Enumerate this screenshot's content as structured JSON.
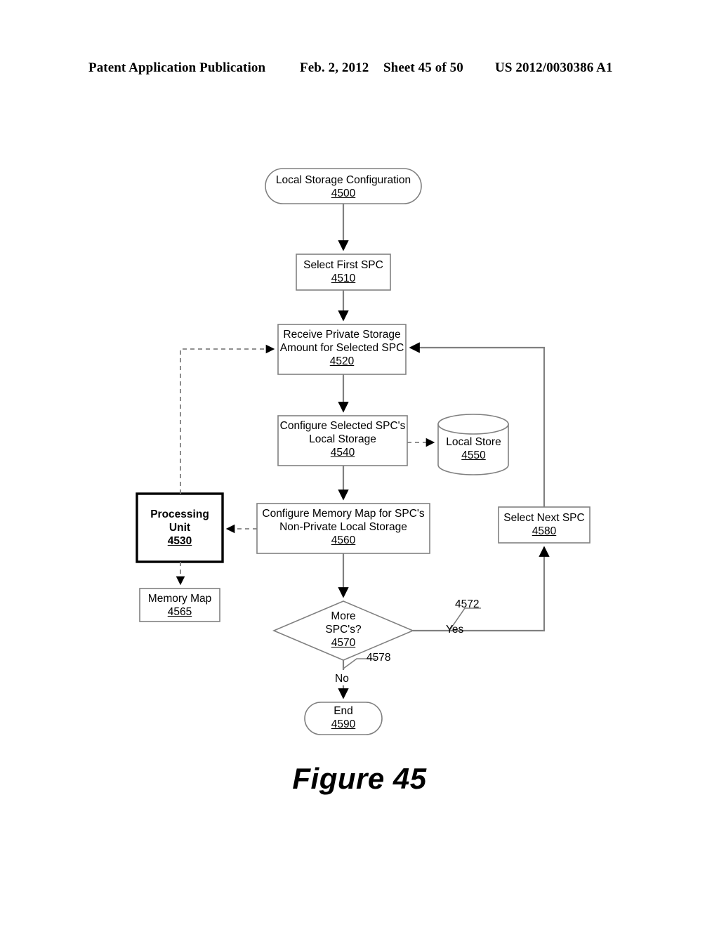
{
  "header": {
    "publication": "Patent Application Publication",
    "date": "Feb. 2, 2012",
    "sheet": "Sheet 45 of 50",
    "patent_number": "US 2012/0030386 A1"
  },
  "figure": {
    "caption": "Figure 45",
    "nodes": {
      "start": {
        "title": "Local Storage Configuration",
        "ref": "4500",
        "shape": "terminator"
      },
      "select_first": {
        "title": "Select First SPC",
        "ref": "4510",
        "shape": "process"
      },
      "receive_amount": {
        "line1": "Receive Private Storage",
        "line2": "Amount for Selected SPC",
        "ref": "4520",
        "shape": "process"
      },
      "configure_storage": {
        "line1": "Configure Selected SPC's",
        "line2": "Local Storage",
        "ref": "4540",
        "shape": "process"
      },
      "local_store": {
        "title": "Local Store",
        "ref": "4550",
        "shape": "cylinder"
      },
      "processing_unit": {
        "line1": "Processing",
        "line2": "Unit",
        "ref": "4530",
        "shape": "process-bold"
      },
      "configure_memory_map": {
        "line1": "Configure Memory Map for SPC's",
        "line2": "Non-Private Local Storage",
        "ref": "4560",
        "shape": "process"
      },
      "memory_map": {
        "title": "Memory Map",
        "ref": "4565",
        "shape": "process"
      },
      "decision": {
        "line1": "More",
        "line2": "SPC's?",
        "ref": "4570",
        "shape": "diamond"
      },
      "select_next": {
        "title": "Select Next SPC",
        "ref": "4580",
        "shape": "process"
      },
      "end": {
        "title": "End",
        "ref": "4590",
        "shape": "terminator"
      }
    },
    "edges": {
      "yes_label": "Yes",
      "no_label": "No",
      "yes_ref": "4572",
      "no_ref": "4578"
    },
    "colors": {
      "stroke": "#808080",
      "stroke_bold": "#000000",
      "arrow_fill": "#000000",
      "text": "#000000",
      "background": "#ffffff"
    }
  }
}
